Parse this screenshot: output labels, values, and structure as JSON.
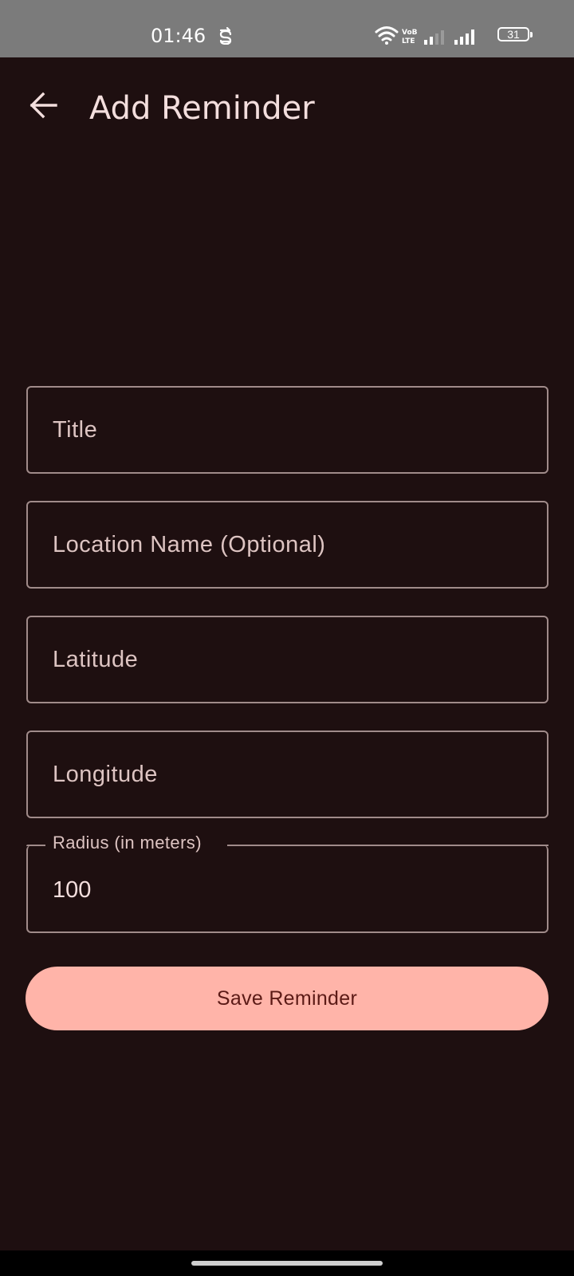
{
  "status_bar": {
    "time": "01:46",
    "battery": "31",
    "icons": [
      "sync-icon",
      "wifi-icon",
      "volte-icon",
      "signal-weak-icon",
      "signal-strong-icon",
      "battery-icon"
    ]
  },
  "app_bar": {
    "title": "Add Reminder",
    "back_icon": "arrow-back-icon"
  },
  "form": {
    "title_placeholder": "Title",
    "location_placeholder": "Location Name (Optional)",
    "latitude_placeholder": "Latitude",
    "longitude_placeholder": "Longitude",
    "radius_label": "Radius (in meters)",
    "radius_value": "100"
  },
  "actions": {
    "save_label": "Save Reminder"
  },
  "colors": {
    "background": "#1e0f10",
    "accent": "#ffb4a9",
    "outline": "#a08b8a",
    "text": "#f3dedd"
  }
}
